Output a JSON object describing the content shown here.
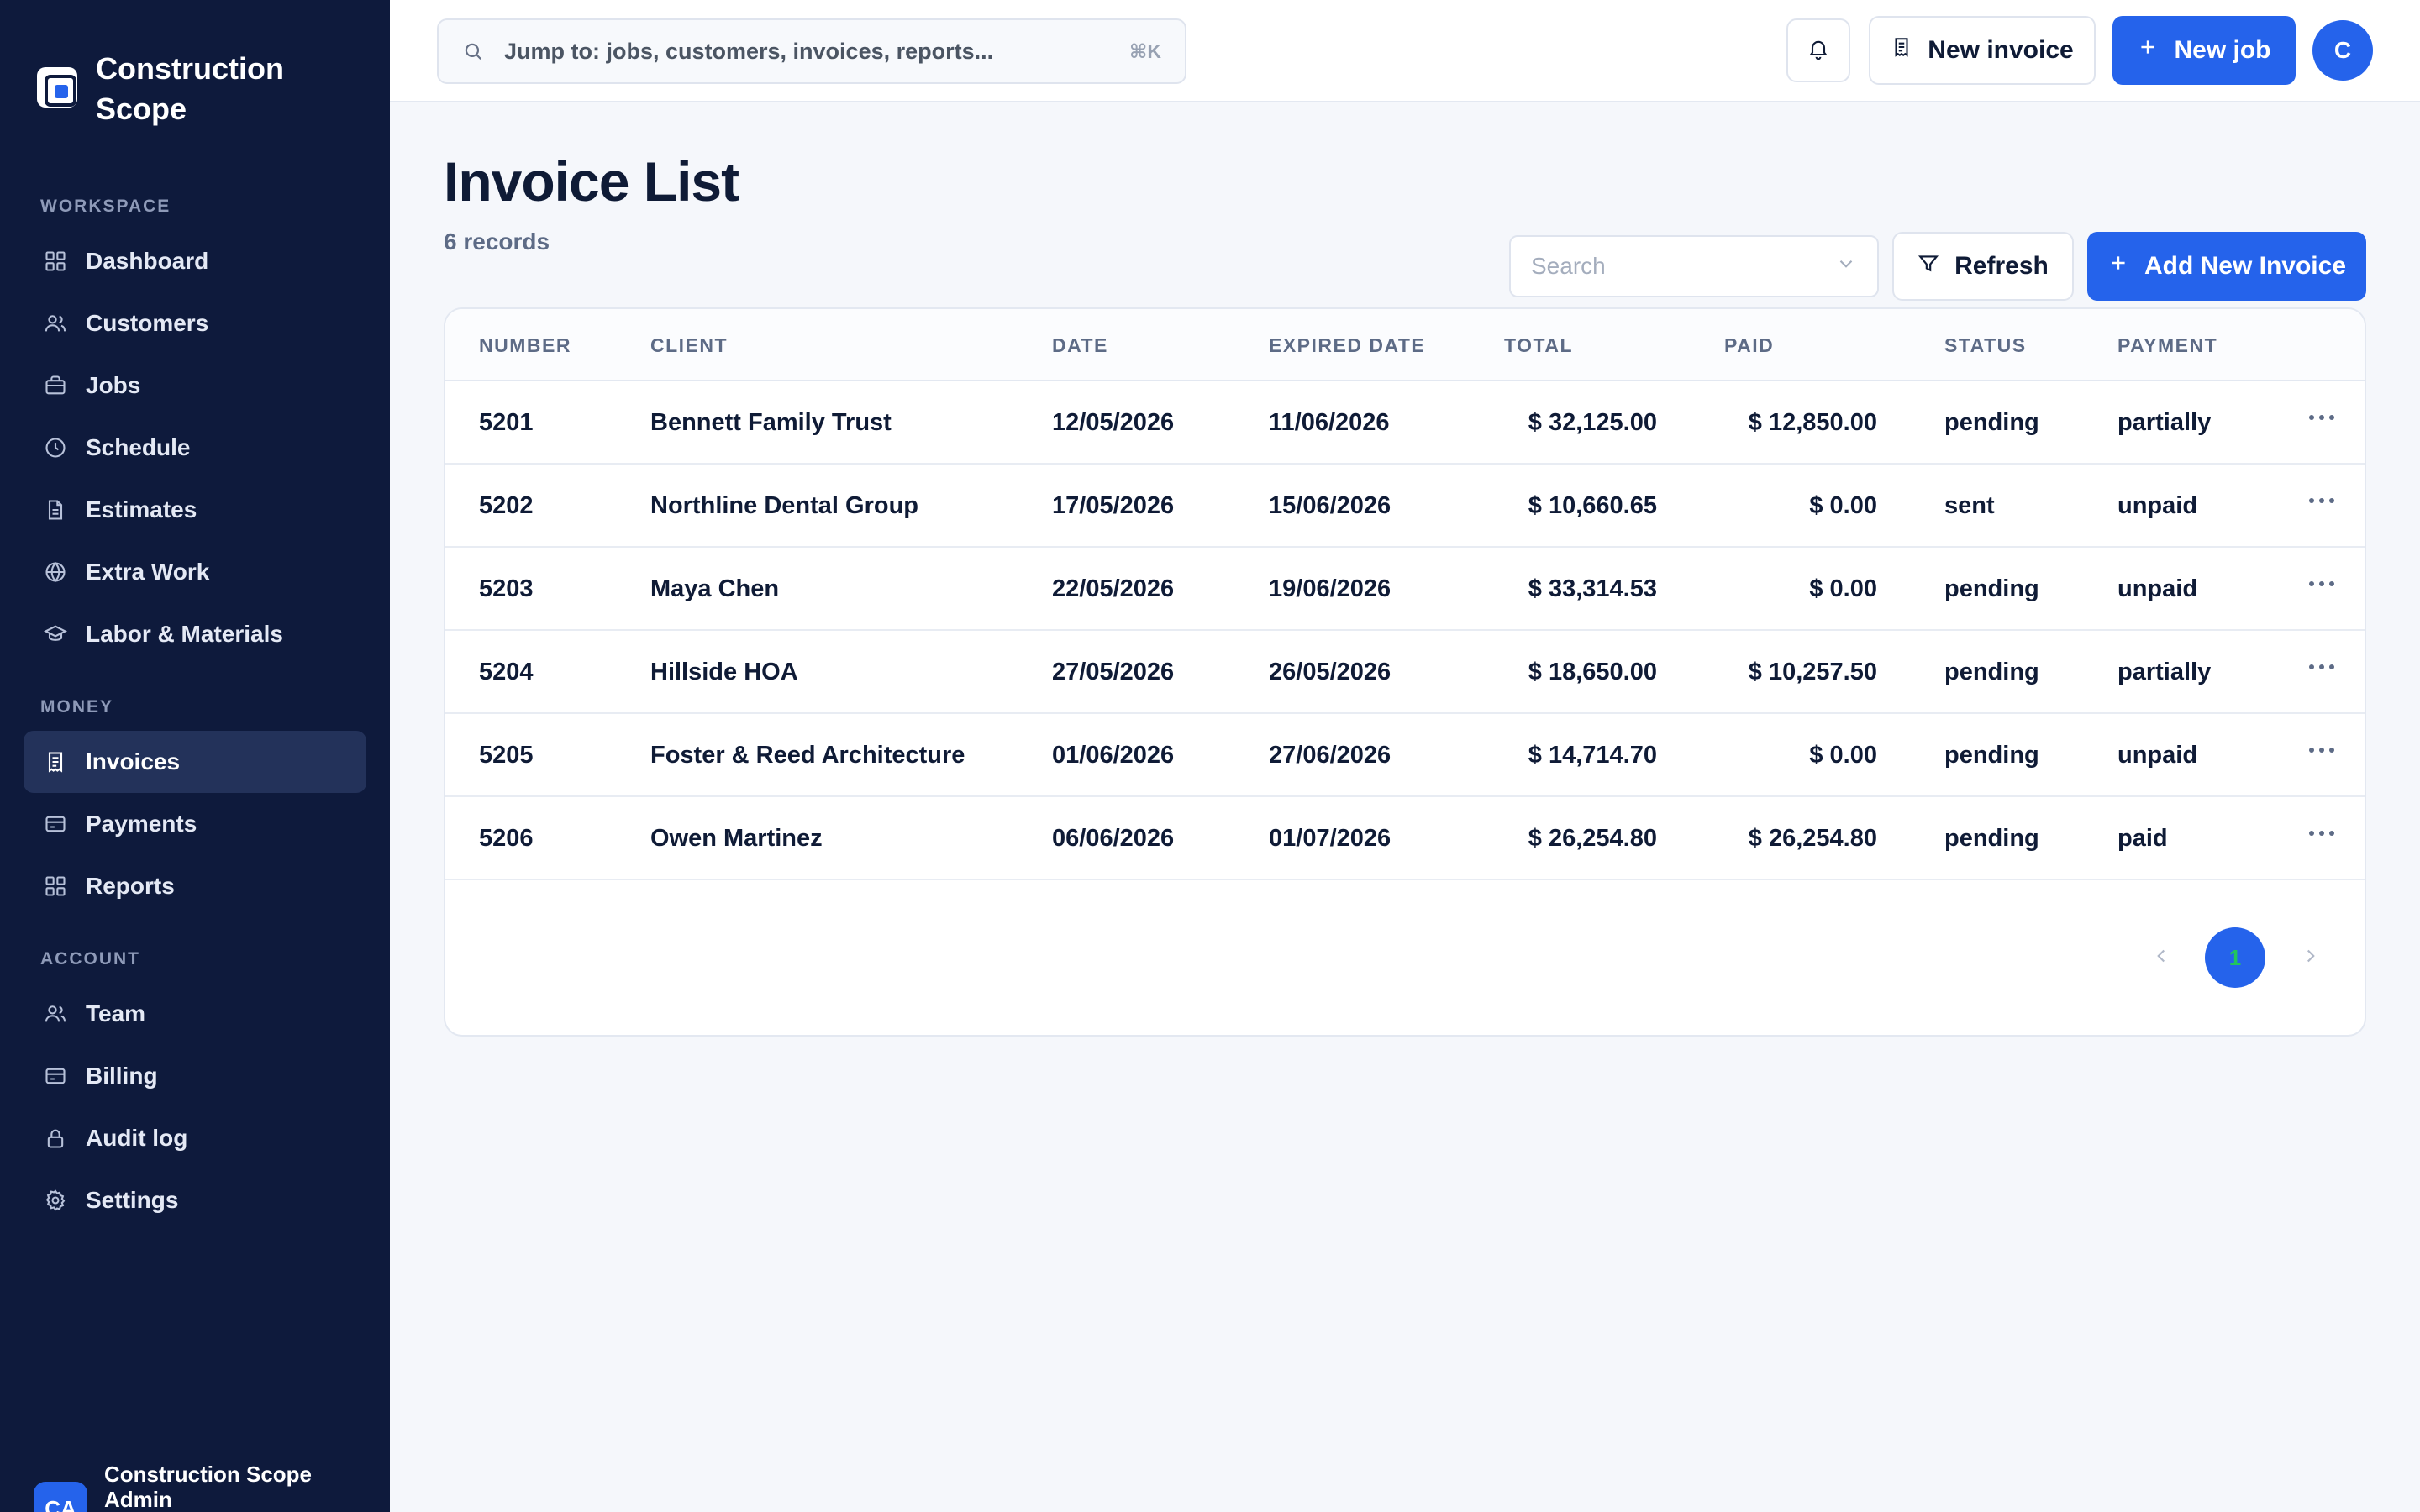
{
  "brand": {
    "name": "Construction Scope"
  },
  "sidebar": {
    "sections": [
      {
        "label": "WORKSPACE",
        "items": [
          {
            "label": "Dashboard",
            "icon": "grid-icon"
          },
          {
            "label": "Customers",
            "icon": "users-icon"
          },
          {
            "label": "Jobs",
            "icon": "briefcase-icon"
          },
          {
            "label": "Schedule",
            "icon": "clock-icon"
          },
          {
            "label": "Estimates",
            "icon": "document-icon"
          },
          {
            "label": "Extra Work",
            "icon": "globe-icon"
          },
          {
            "label": "Labor & Materials",
            "icon": "graduation-cap-icon"
          }
        ]
      },
      {
        "label": "MONEY",
        "items": [
          {
            "label": "Invoices",
            "icon": "receipt-icon",
            "active": true
          },
          {
            "label": "Payments",
            "icon": "credit-card-icon"
          },
          {
            "label": "Reports",
            "icon": "grid-icon"
          }
        ]
      },
      {
        "label": "ACCOUNT",
        "items": [
          {
            "label": "Team",
            "icon": "users-icon"
          },
          {
            "label": "Billing",
            "icon": "credit-card-icon"
          },
          {
            "label": "Audit log",
            "icon": "lock-icon"
          },
          {
            "label": "Settings",
            "icon": "gear-icon"
          }
        ]
      }
    ],
    "user": {
      "initials": "CA",
      "name": "Construction Scope Admin"
    }
  },
  "topbar": {
    "search_placeholder": "Jump to: jobs, customers, invoices, reports...",
    "shortcut": "⌘K",
    "new_invoice_label": "New invoice",
    "new_job_label": "New job",
    "avatar_initial": "C"
  },
  "page": {
    "title": "Invoice List",
    "record_count": "6 records",
    "search_placeholder": "Search",
    "refresh_label": "Refresh",
    "add_label": "Add New Invoice"
  },
  "table": {
    "columns": [
      "NUMBER",
      "CLIENT",
      "DATE",
      "EXPIRED DATE",
      "TOTAL",
      "PAID",
      "STATUS",
      "PAYMENT"
    ],
    "rows": [
      {
        "number": "5201",
        "client": "Bennett Family Trust",
        "date": "12/05/2026",
        "expired": "11/06/2026",
        "total": "$ 32,125.00",
        "paid": "$ 12,850.00",
        "status": "pending",
        "payment": "partially"
      },
      {
        "number": "5202",
        "client": "Northline Dental Group",
        "date": "17/05/2026",
        "expired": "15/06/2026",
        "total": "$ 10,660.65",
        "paid": "$ 0.00",
        "status": "sent",
        "payment": "unpaid"
      },
      {
        "number": "5203",
        "client": "Maya Chen",
        "date": "22/05/2026",
        "expired": "19/06/2026",
        "total": "$ 33,314.53",
        "paid": "$ 0.00",
        "status": "pending",
        "payment": "unpaid"
      },
      {
        "number": "5204",
        "client": "Hillside HOA",
        "date": "27/05/2026",
        "expired": "26/05/2026",
        "total": "$ 18,650.00",
        "paid": "$ 10,257.50",
        "status": "pending",
        "payment": "partially"
      },
      {
        "number": "5205",
        "client": "Foster & Reed Architecture",
        "date": "01/06/2026",
        "expired": "27/06/2026",
        "total": "$ 14,714.70",
        "paid": "$ 0.00",
        "status": "pending",
        "payment": "unpaid"
      },
      {
        "number": "5206",
        "client": "Owen Martinez",
        "date": "06/06/2026",
        "expired": "01/07/2026",
        "total": "$ 26,254.80",
        "paid": "$ 26,254.80",
        "status": "pending",
        "payment": "paid"
      }
    ]
  },
  "pagination": {
    "current_page": "1"
  },
  "colors": {
    "sidebar": "#0e1a3c",
    "accent": "#2563eb",
    "background": "#f5f7fb"
  }
}
